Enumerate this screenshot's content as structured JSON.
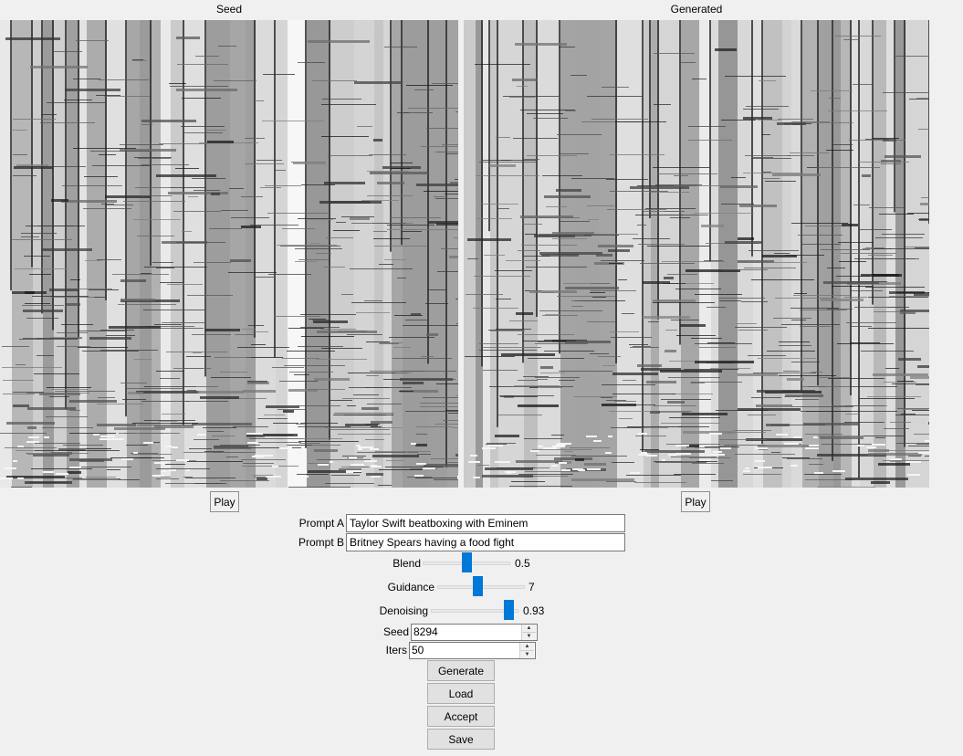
{
  "panels": {
    "seed_caption": "Seed",
    "generated_caption": "Generated",
    "play_label": "Play"
  },
  "prompts": {
    "a_label": "Prompt A",
    "a_value": "Taylor Swift beatboxing with Eminem",
    "b_label": "Prompt B",
    "b_value": "Britney Spears having a food fight"
  },
  "sliders": {
    "blend": {
      "label": "Blend",
      "value": "0.5",
      "fraction": 0.5
    },
    "guidance": {
      "label": "Guidance",
      "value": "7",
      "fraction": 0.47
    },
    "denoising": {
      "label": "Denoising",
      "value": "0.93",
      "fraction": 0.93
    }
  },
  "spinboxes": {
    "seed": {
      "label": "Seed",
      "value": "8294"
    },
    "iters": {
      "label": "Iters",
      "value": "50"
    }
  },
  "buttons": {
    "generate": "Generate",
    "load": "Load",
    "accept": "Accept",
    "save": "Save"
  },
  "colors": {
    "slider_thumb": "#0078d7",
    "window_bg": "#f0f0f0"
  }
}
